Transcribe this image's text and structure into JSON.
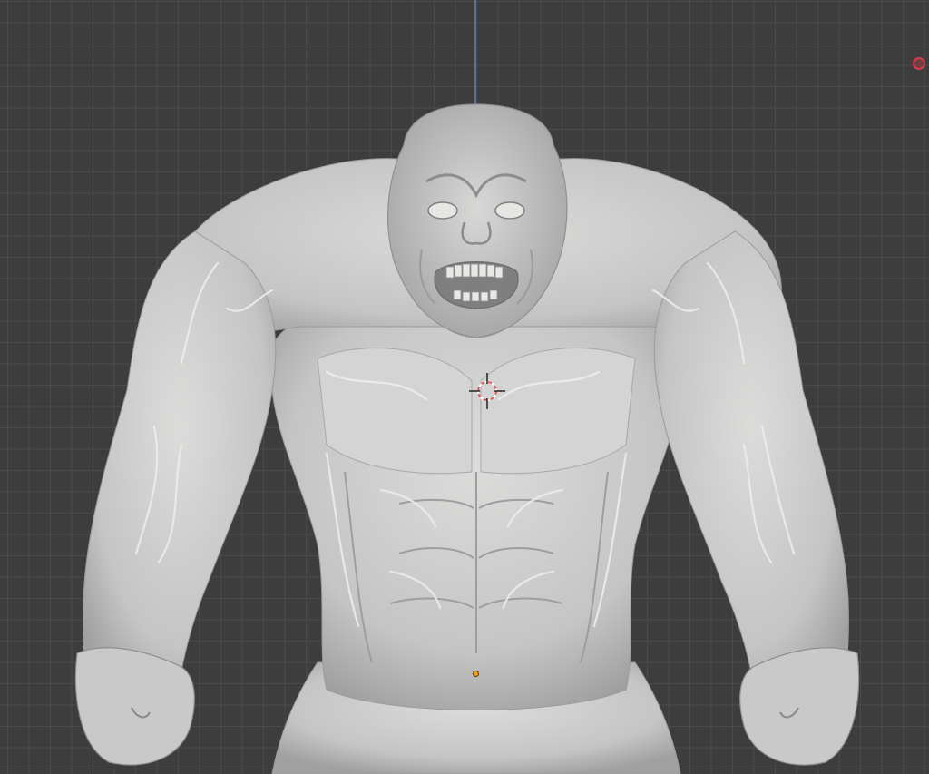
{
  "viewport": {
    "background": "#3d3d3d",
    "grid_color": "#4a4a4a",
    "axis_color": "#5b83c3"
  },
  "scene": {
    "sculpt_color": "#cfd0cf",
    "icons": {
      "cursor": "3d-cursor-icon",
      "origin": "object-origin-icon",
      "record": "record-indicator-icon"
    },
    "accent": {
      "origin": "#f3a21e",
      "record": "#d23c4e",
      "cursor": "#e0585a"
    }
  }
}
